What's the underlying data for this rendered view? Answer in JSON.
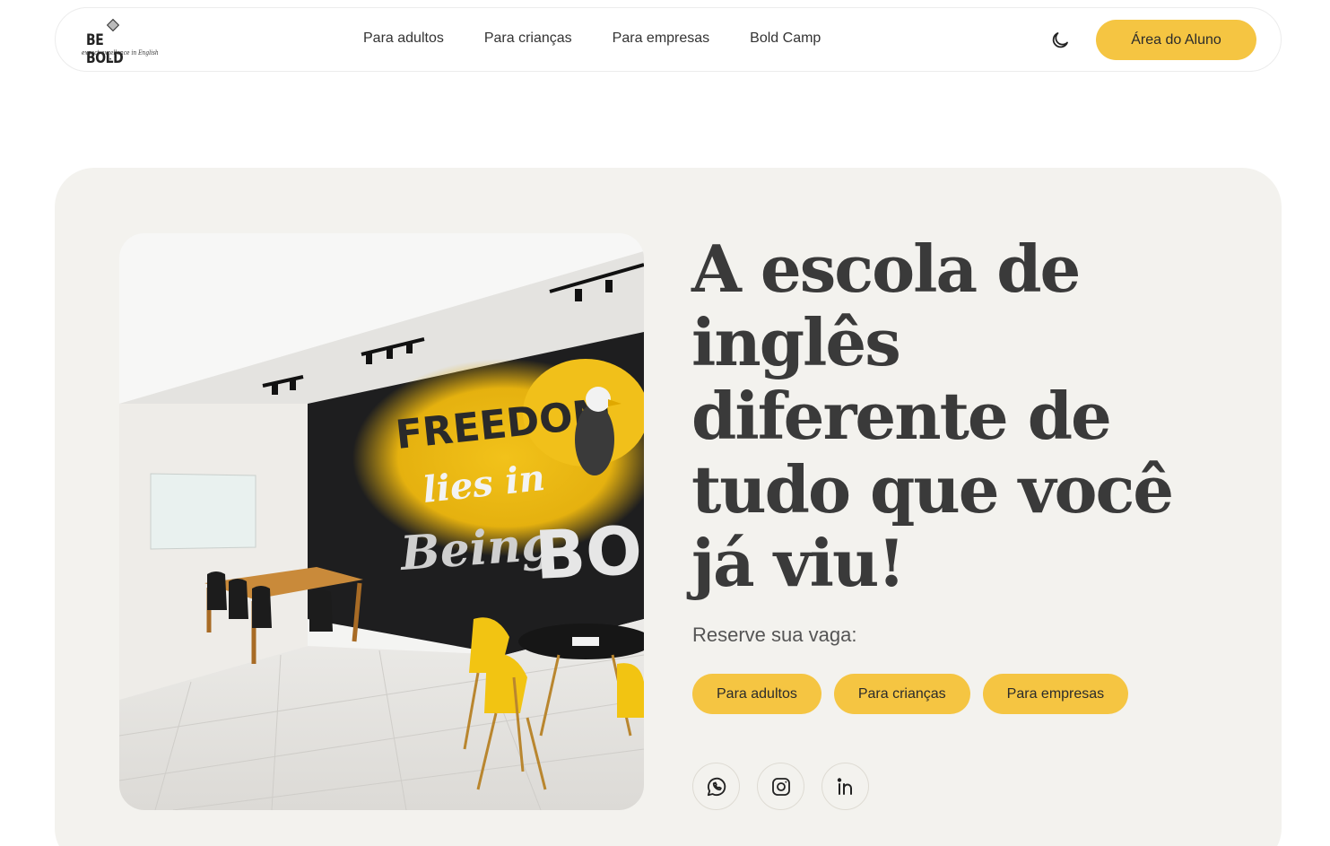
{
  "header": {
    "logo": {
      "wordmark": "BE BOLD",
      "tagline": "expect excellence in English"
    },
    "nav": [
      {
        "label": "Para adultos"
      },
      {
        "label": "Para crianças"
      },
      {
        "label": "Para empresas"
      },
      {
        "label": "Bold Camp"
      }
    ],
    "theme_toggle_icon": "moon-icon",
    "student_area_label": "Área do Aluno"
  },
  "hero": {
    "headline": "A escola de inglês diferente de tudo que você já viu!",
    "photo": {
      "mural_lines": [
        "FREEDOM",
        "lies in",
        "Being",
        "BOLD"
      ]
    },
    "reserve_label": "Reserve sua vaga:",
    "cta_buttons": [
      {
        "label": "Para adultos"
      },
      {
        "label": "Para crianças"
      },
      {
        "label": "Para empresas"
      }
    ],
    "socials": [
      {
        "icon": "whatsapp-icon"
      },
      {
        "icon": "instagram-icon"
      },
      {
        "icon": "linkedin-icon"
      }
    ]
  },
  "colors": {
    "accent": "#f5c542",
    "hero_bg": "#f3f2ee",
    "text": "#3a3a3a"
  }
}
